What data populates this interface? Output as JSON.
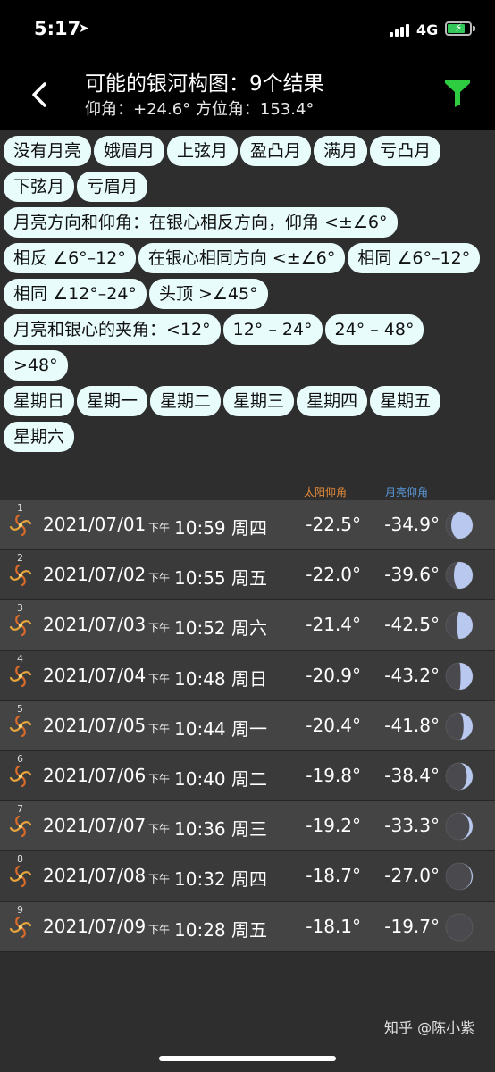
{
  "status_bar": {
    "time": "5:17",
    "network": "4G"
  },
  "nav": {
    "title": "可能的银河构图：9个结果",
    "subtitle": "仰角：+24.6° 方位角：153.4°"
  },
  "filters": {
    "moon_phase": [
      "没有月亮",
      "娥眉月",
      "上弦月",
      "盈凸月",
      "满月",
      "亏凸月",
      "下弦月",
      "亏眉月"
    ],
    "direction_header": "月亮方向和仰角：在银心相反方向，仰角 <±∠6°",
    "direction": [
      "相反 ∠6°–12°",
      "在银心相同方向 <±∠6°",
      "相同 ∠6°–12°",
      "相同 ∠12°–24°",
      "头顶 >∠45°"
    ],
    "angle": [
      "月亮和银心的夹角：<12°",
      "12° – 24°",
      "24° – 48°",
      ">48°"
    ],
    "weekdays": [
      "星期日",
      "星期一",
      "星期二",
      "星期三",
      "星期四",
      "星期五",
      "星期六"
    ]
  },
  "table": {
    "sun_header": "太阳仰角",
    "moon_header": "月亮仰角",
    "rows": [
      {
        "index": "1",
        "date": "2021/07/01",
        "ampm": "下午",
        "time": "10:59",
        "weekday": "周四",
        "sun": "-22.5°",
        "moon": "-34.9°",
        "lit": 0.8
      },
      {
        "index": "2",
        "date": "2021/07/02",
        "ampm": "下午",
        "time": "10:55",
        "weekday": "周五",
        "sun": "-22.0°",
        "moon": "-39.6°",
        "lit": 0.7
      },
      {
        "index": "3",
        "date": "2021/07/03",
        "ampm": "下午",
        "time": "10:52",
        "weekday": "周六",
        "sun": "-21.4°",
        "moon": "-42.5°",
        "lit": 0.58
      },
      {
        "index": "4",
        "date": "2021/07/04",
        "ampm": "下午",
        "time": "10:48",
        "weekday": "周日",
        "sun": "-20.9°",
        "moon": "-43.2°",
        "lit": 0.45
      },
      {
        "index": "5",
        "date": "2021/07/05",
        "ampm": "下午",
        "time": "10:44",
        "weekday": "周一",
        "sun": "-20.4°",
        "moon": "-41.8°",
        "lit": 0.34
      },
      {
        "index": "6",
        "date": "2021/07/06",
        "ampm": "下午",
        "time": "10:40",
        "weekday": "周二",
        "sun": "-19.8°",
        "moon": "-38.4°",
        "lit": 0.22
      },
      {
        "index": "7",
        "date": "2021/07/07",
        "ampm": "下午",
        "time": "10:36",
        "weekday": "周三",
        "sun": "-19.2°",
        "moon": "-33.3°",
        "lit": 0.12
      },
      {
        "index": "8",
        "date": "2021/07/08",
        "ampm": "下午",
        "time": "10:32",
        "weekday": "周四",
        "sun": "-18.7°",
        "moon": "-27.0°",
        "lit": 0.04
      },
      {
        "index": "9",
        "date": "2021/07/09",
        "ampm": "下午",
        "time": "10:28",
        "weekday": "周五",
        "sun": "-18.1°",
        "moon": "-19.7°",
        "lit": 0.01
      }
    ]
  },
  "watermark": "知乎 @陈小紫",
  "colors": {
    "chip_bg": "#e8fcfc",
    "filter_icon": "#2ecc40",
    "sun_header": "#e48a3a",
    "moon_header": "#5b9bdc",
    "moon_lit": "#b8c8ee",
    "moon_dark": "#4a4a4e"
  },
  "icons": {
    "back": "chevron-left-icon",
    "filter": "funnel-icon",
    "row": "galaxy-icon",
    "moon": "moon-phase-icon"
  }
}
